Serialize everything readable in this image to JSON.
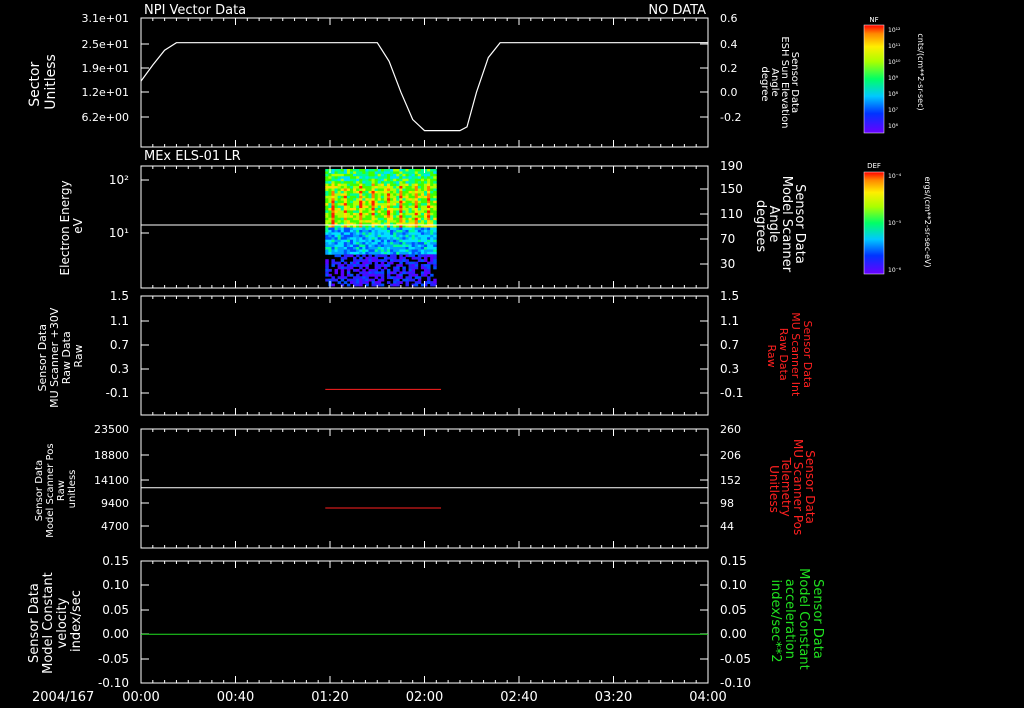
{
  "colors": {
    "background": "#000000",
    "foreground": "#ffffff",
    "red": "#ff2020",
    "green": "#20e020"
  },
  "header": {
    "panel1_title": "NPI Vector Data",
    "status": "NO DATA",
    "panel2_title": "MEx ELS-01 LR"
  },
  "time_axis": {
    "start_label": "2004/167",
    "ticks": [
      "00:00",
      "00:40",
      "01:20",
      "02:00",
      "02:40",
      "03:20",
      "04:00"
    ],
    "range_minutes": [
      0,
      240
    ]
  },
  "panels": {
    "p1": {
      "left_label": [
        "Sector",
        "Unitless"
      ],
      "right_label": [
        "Sensor Data",
        "ESH Sun Elevation",
        "Angle",
        "degree"
      ],
      "left_ticks": [
        "3.1e+01",
        "2.5e+01",
        "1.9e+01",
        "1.2e+01",
        "6.2e+00"
      ],
      "right_ticks": [
        "0.6",
        "0.4",
        "0.2",
        "0.0",
        "-0.2"
      ]
    },
    "p2": {
      "left_label": [
        "Electron Energy",
        "eV"
      ],
      "right_label": [
        "Sensor Data",
        "Model Scanner",
        "Angle",
        "degrees"
      ],
      "left_ticks": [
        "10²",
        "10¹"
      ],
      "right_ticks": [
        "190",
        "150",
        "110",
        "70",
        "30"
      ]
    },
    "p3": {
      "left_label": [
        "Sensor Data",
        "MU Scanner +30V",
        "Raw Data",
        "Raw"
      ],
      "right_label": [
        "Sensor Data",
        "MU Scanner Int",
        "Raw Data",
        "Raw"
      ],
      "left_ticks": [
        "1.5",
        "1.1",
        "0.7",
        "0.3",
        "-0.1"
      ],
      "right_ticks": [
        "1.5",
        "1.1",
        "0.7",
        "0.3",
        "-0.1"
      ]
    },
    "p4": {
      "left_label": [
        "Sensor Data",
        "Model Scanner Pos",
        "Raw",
        "unitless"
      ],
      "right_label": [
        "Sensor Data",
        "MU Scanner Pos",
        "Telemetry",
        "Unitless"
      ],
      "left_ticks": [
        "23500",
        "18800",
        "14100",
        "9400",
        "4700"
      ],
      "right_ticks": [
        "260",
        "206",
        "152",
        "98",
        "44"
      ]
    },
    "p5": {
      "left_label": [
        "Sensor Data",
        "Model Constant",
        "velocity",
        "index/sec"
      ],
      "right_label": [
        "Sensor Data",
        "Model Constant",
        "acceleration",
        "index/sec**2"
      ],
      "left_ticks": [
        "0.15",
        "0.10",
        "0.05",
        "0.00",
        "-0.05",
        "-0.10"
      ],
      "right_ticks": [
        "0.15",
        "0.10",
        "0.05",
        "0.00",
        "-0.05",
        "-0.10"
      ]
    }
  },
  "colorbars": {
    "nf": {
      "label": "NF",
      "unit": "cnts/(cm**2-sr-sec)",
      "ticks": [
        "10¹²",
        "10¹¹",
        "10¹⁰",
        "10⁹",
        "10⁸",
        "10⁷",
        "10⁶"
      ]
    },
    "def": {
      "label": "DEF",
      "unit": "ergs/(cm**2-sr-sec-eV)",
      "ticks": [
        "10⁻⁴",
        "10⁻⁵",
        "10⁻⁶"
      ]
    }
  },
  "chart_data": [
    {
      "type": "line",
      "panel": "p1",
      "title": "NPI Vector Data",
      "ylabel": "Sensor Data ESH Sun Elevation Angle degree",
      "ylim": [
        -0.32,
        0.6
      ],
      "x_minutes": [
        0,
        5,
        10,
        15,
        20,
        60,
        100,
        105,
        110,
        115,
        120,
        125,
        135,
        138,
        142,
        147,
        152,
        157,
        240
      ],
      "y": [
        0.09,
        0.22,
        0.34,
        0.4,
        0.4,
        0.4,
        0.4,
        0.25,
        0.0,
        -0.22,
        -0.31,
        -0.31,
        -0.31,
        -0.28,
        0.0,
        0.28,
        0.4,
        0.4,
        0.4
      ]
    },
    {
      "type": "heatmap",
      "panel": "p2",
      "title": "MEx ELS-01 LR",
      "ylabel": "Electron Energy eV",
      "x_range_minutes": [
        78,
        125
      ],
      "energy_range_eV": [
        1,
        180
      ],
      "reference_line_deg": 92
    },
    {
      "type": "line",
      "panel": "p3",
      "ylabel": "Sensor Data MU Scanner Int Raw Data Raw",
      "ylim": [
        -0.3,
        1.5
      ],
      "series": [
        {
          "x_minutes": [
            78,
            127
          ],
          "y": [
            -0.04,
            -0.04
          ],
          "color": "red"
        }
      ]
    },
    {
      "type": "line",
      "panel": "p4",
      "ylabel": "Model Scanner Pos Raw unitless / MU Scanner Pos Telemetry Unitless",
      "series": [
        {
          "axis": "left",
          "x_minutes": [
            0,
            240
          ],
          "y": [
            11900,
            11900
          ],
          "ylim": [
            0,
            23500
          ],
          "color": "white"
        },
        {
          "axis": "right",
          "x_minutes": [
            78,
            127
          ],
          "y": [
            88,
            88
          ],
          "ylim": [
            0,
            260
          ],
          "color": "red"
        }
      ]
    },
    {
      "type": "line",
      "panel": "p5",
      "ylabel": "Model Constant velocity index/sec",
      "ylim": [
        -0.1,
        0.15
      ],
      "series": [
        {
          "x_minutes": [
            0,
            240
          ],
          "y": [
            0.0,
            0.0
          ],
          "color": "green"
        }
      ]
    }
  ]
}
